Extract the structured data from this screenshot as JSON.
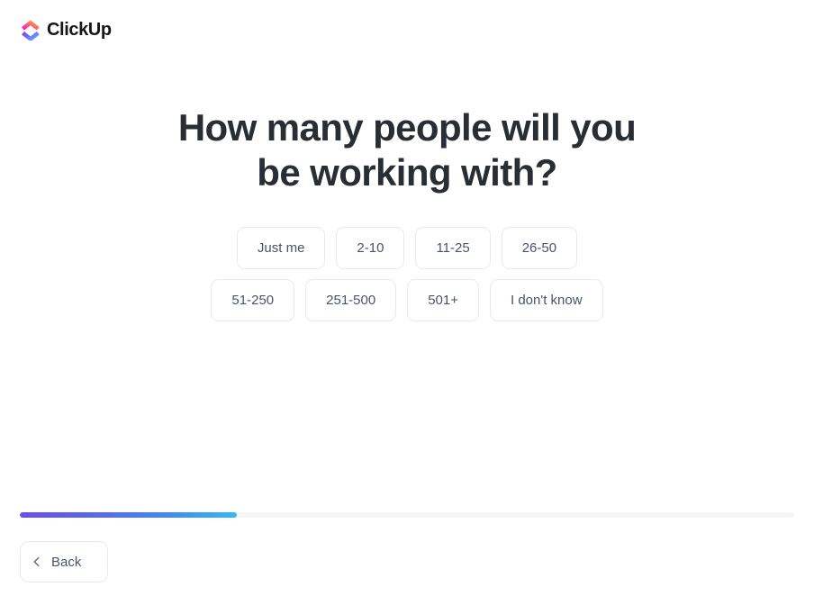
{
  "brand": {
    "name": "ClickUp",
    "logo_icon": "clickup-chevron-logo",
    "logo_top_gradient": [
      "#FF02F0",
      "#FFC800"
    ],
    "logo_bottom_gradient": [
      "#8930FD",
      "#49CCF9"
    ],
    "wordmark_color": "#15161a"
  },
  "main": {
    "title": "How many people will you be working with?",
    "title_line_1": "How many people will you",
    "title_line_2": "be working with?",
    "title_color": "#292d34",
    "options_row_1": [
      {
        "label": "Just me"
      },
      {
        "label": "2-10"
      },
      {
        "label": "11-25"
      },
      {
        "label": "26-50"
      }
    ],
    "options_row_2": [
      {
        "label": "51-250"
      },
      {
        "label": "251-500"
      },
      {
        "label": "501+"
      },
      {
        "label": "I don't know"
      }
    ],
    "option_text_color": "#48546b",
    "option_border_color": "#e9eaee"
  },
  "progress": {
    "percent": 28,
    "track_color": "#f4f5f7",
    "fill_gradient_start": "#6a4ef0",
    "fill_gradient_end": "#36b7f7"
  },
  "footer": {
    "back_label": "Back",
    "back_icon": "chevron-left-icon"
  }
}
